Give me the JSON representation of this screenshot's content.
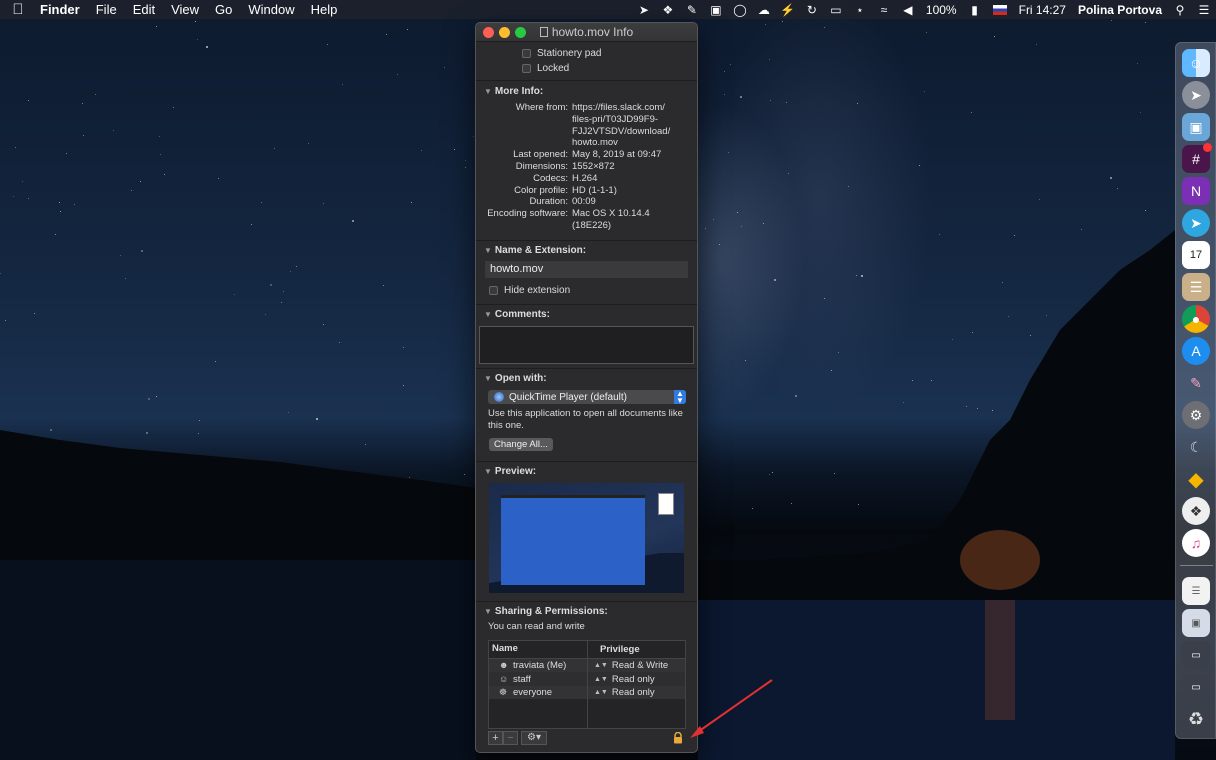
{
  "menubar": {
    "apple_icon": "apple-icon",
    "app_name": "Finder",
    "items": [
      "File",
      "Edit",
      "View",
      "Go",
      "Window",
      "Help"
    ],
    "battery": "100%",
    "clock": "Fri 14:27",
    "user": "Polina Portova"
  },
  "window": {
    "title": "howto.mov Info",
    "general": {
      "stationery_label": "Stationery pad",
      "locked_label": "Locked"
    },
    "more_info": {
      "header": "More Info:",
      "rows": [
        {
          "key": "Where from:",
          "value": "https://files.slack.com/ files-pri/T03JD99F9- FJJ2VTSDV/download/ howto.mov"
        },
        {
          "key": "Last opened:",
          "value": "May 8, 2019 at 09:47"
        },
        {
          "key": "Dimensions:",
          "value": "1552×872"
        },
        {
          "key": "Codecs:",
          "value": "H.264"
        },
        {
          "key": "Color profile:",
          "value": "HD (1-1-1)"
        },
        {
          "key": "Duration:",
          "value": "00:09"
        },
        {
          "key": "Encoding software:",
          "value": "Mac OS X 10.14.4 (18E226)"
        }
      ]
    },
    "name_ext": {
      "header": "Name & Extension:",
      "filename": "howto.mov",
      "hide_ext_label": "Hide extension"
    },
    "comments": {
      "header": "Comments:",
      "value": ""
    },
    "open_with": {
      "header": "Open with:",
      "app": "QuickTime Player (default)",
      "note": "Use this application to open all documents like this one.",
      "change_all": "Change All..."
    },
    "preview": {
      "header": "Preview:"
    },
    "sharing": {
      "header": "Sharing & Permissions:",
      "summary": "You can read and write",
      "col_name": "Name",
      "col_privilege": "Privilege",
      "rows": [
        {
          "name": "traviata (Me)",
          "privilege": "Read & Write"
        },
        {
          "name": "staff",
          "privilege": "Read only"
        },
        {
          "name": "everyone",
          "privilege": "Read only"
        }
      ],
      "add": "+",
      "remove": "−"
    }
  },
  "dock": {
    "apps": [
      "finder",
      "launchpad",
      "preview",
      "slack",
      "onenote",
      "telegram",
      "calendar",
      "notes",
      "chrome",
      "app-store",
      "brush",
      "system-preferences",
      "activity",
      "sketch",
      "dropbox",
      "itunes",
      "document",
      "photos",
      "window-1",
      "window-2",
      "trash"
    ]
  }
}
